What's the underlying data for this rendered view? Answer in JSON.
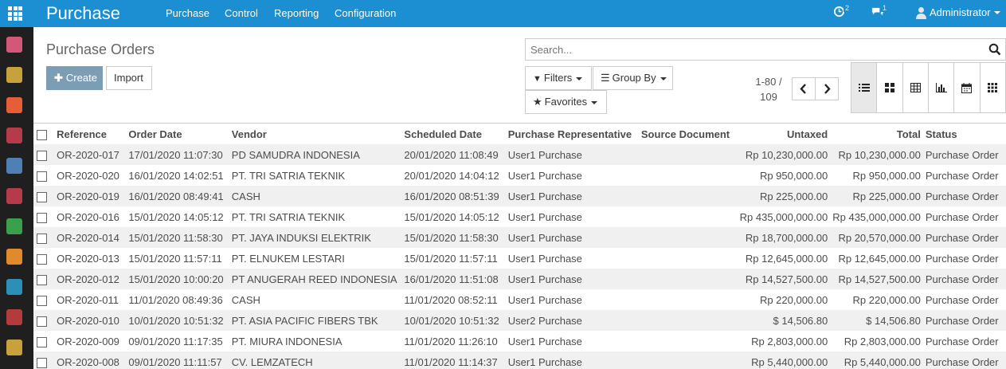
{
  "app": {
    "title": "Purchase"
  },
  "top_menu": [
    "Purchase",
    "Control",
    "Reporting",
    "Configuration"
  ],
  "systray": {
    "activity_count": "2",
    "message_count": "1",
    "user": "Administrator"
  },
  "sidebar_icons": [
    "discuss-icon",
    "calendar-icon",
    "dashboard-icon",
    "inventory-icon",
    "accounting-icon",
    "purchase-icon",
    "settings-wrench-icon",
    "invoice-icon",
    "employees-icon",
    "apps-icon",
    "settings-gear-icon"
  ],
  "sidebar_colors": [
    "#d35778",
    "#c7a23c",
    "#e55e36",
    "#b53b4a",
    "#4f7fb5",
    "#b53b4a",
    "#3aa04b",
    "#e08a2c",
    "#2b8fb7",
    "#b43b3b",
    "#c7a23c"
  ],
  "breadcrumb": "Purchase Orders",
  "buttons": {
    "create": "Create",
    "import": "Import"
  },
  "search": {
    "placeholder": "Search..."
  },
  "filters": {
    "filters": "Filters",
    "group_by": "Group By",
    "favorites": "Favorites"
  },
  "pager": {
    "range": "1-80 /",
    "total": "109"
  },
  "views": [
    "list",
    "kanban",
    "pivot",
    "graph",
    "calendar",
    "activity"
  ],
  "columns": [
    "Reference",
    "Order Date",
    "Vendor",
    "Scheduled Date",
    "Purchase Representative",
    "Source Document",
    "Untaxed",
    "Total",
    "Status"
  ],
  "rows": [
    [
      "OR-2020-017",
      "17/01/2020 11:07:30",
      "PD SAMUDRA INDONESIA",
      "20/01/2020 11:08:49",
      "User1 Purchase",
      "",
      "Rp 10,230,000.00",
      "Rp 10,230,000.00",
      "Purchase Order"
    ],
    [
      "OR-2020-020",
      "16/01/2020 14:02:51",
      "PT. TRI SATRIA TEKNIK",
      "20/01/2020 14:04:12",
      "User1 Purchase",
      "",
      "Rp 950,000.00",
      "Rp 950,000.00",
      "Purchase Order"
    ],
    [
      "OR-2020-019",
      "16/01/2020 08:49:41",
      "CASH",
      "16/01/2020 08:51:39",
      "User1 Purchase",
      "",
      "Rp 225,000.00",
      "Rp 225,000.00",
      "Purchase Order"
    ],
    [
      "OR-2020-016",
      "15/01/2020 14:05:12",
      "PT. TRI SATRIA TEKNIK",
      "15/01/2020 14:05:12",
      "User1 Purchase",
      "",
      "Rp 435,000,000.00",
      "Rp 435,000,000.00",
      "Purchase Order"
    ],
    [
      "OR-2020-014",
      "15/01/2020 11:58:30",
      "PT. JAYA INDUKSI ELEKTRIK",
      "15/01/2020 11:58:30",
      "User1 Purchase",
      "",
      "Rp 18,700,000.00",
      "Rp 20,570,000.00",
      "Purchase Order"
    ],
    [
      "OR-2020-013",
      "15/01/2020 11:57:11",
      "PT. ELNUKEM LESTARI",
      "15/01/2020 11:57:11",
      "User1 Purchase",
      "",
      "Rp 12,645,000.00",
      "Rp 12,645,000.00",
      "Purchase Order"
    ],
    [
      "OR-2020-012",
      "15/01/2020 10:00:20",
      "PT ANUGERAH REED INDONESIA",
      "16/01/2020 11:51:08",
      "User1 Purchase",
      "",
      "Rp 14,527,500.00",
      "Rp 14,527,500.00",
      "Purchase Order"
    ],
    [
      "OR-2020-011",
      "11/01/2020 08:49:36",
      "CASH",
      "11/01/2020 08:52:11",
      "User1 Purchase",
      "",
      "Rp 220,000.00",
      "Rp 220,000.00",
      "Purchase Order"
    ],
    [
      "OR-2020-010",
      "10/01/2020 10:51:32",
      "PT. ASIA PACIFIC FIBERS TBK",
      "10/01/2020 10:51:32",
      "User2 Purchase",
      "",
      "$ 14,506.80",
      "$ 14,506.80",
      "Purchase Order"
    ],
    [
      "OR-2020-009",
      "09/01/2020 11:17:35",
      "PT. MIURA INDONESIA",
      "11/01/2020 11:26:10",
      "User1 Purchase",
      "",
      "Rp 2,803,000.00",
      "Rp 2,803,000.00",
      "Purchase Order"
    ],
    [
      "OR-2020-008",
      "09/01/2020 11:11:57",
      "CV. LEMZATECH",
      "11/01/2020 11:14:37",
      "User1 Purchase",
      "",
      "Rp 5,440,000.00",
      "Rp 5,440,000.00",
      "Purchase Order"
    ]
  ]
}
